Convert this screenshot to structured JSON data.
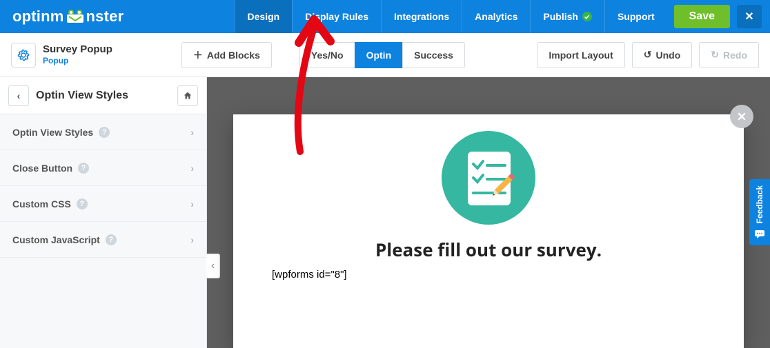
{
  "nav": {
    "logo_pre": "optinm",
    "logo_post": "nster",
    "items": [
      {
        "label": "Design",
        "active": true
      },
      {
        "label": "Display Rules"
      },
      {
        "label": "Integrations"
      },
      {
        "label": "Analytics"
      },
      {
        "label": "Publish",
        "complete": true
      },
      {
        "label": "Support"
      }
    ],
    "save_label": "Save"
  },
  "campaign": {
    "name": "Survey Popup",
    "type": "Popup"
  },
  "toolbar": {
    "add_blocks": "Add Blocks",
    "tabs": [
      "Yes/No",
      "Optin",
      "Success"
    ],
    "active_tab": "Optin",
    "import_layout": "Import Layout",
    "undo": "Undo",
    "redo": "Redo"
  },
  "sidebar": {
    "view_title": "Optin View Styles",
    "panels": [
      "Optin View Styles",
      "Close Button",
      "Custom CSS",
      "Custom JavaScript"
    ]
  },
  "popup": {
    "headline": "Please fill out our survey.",
    "shortcode": "[wpforms id=\"8\"]"
  },
  "feedback_label": "Feedback"
}
